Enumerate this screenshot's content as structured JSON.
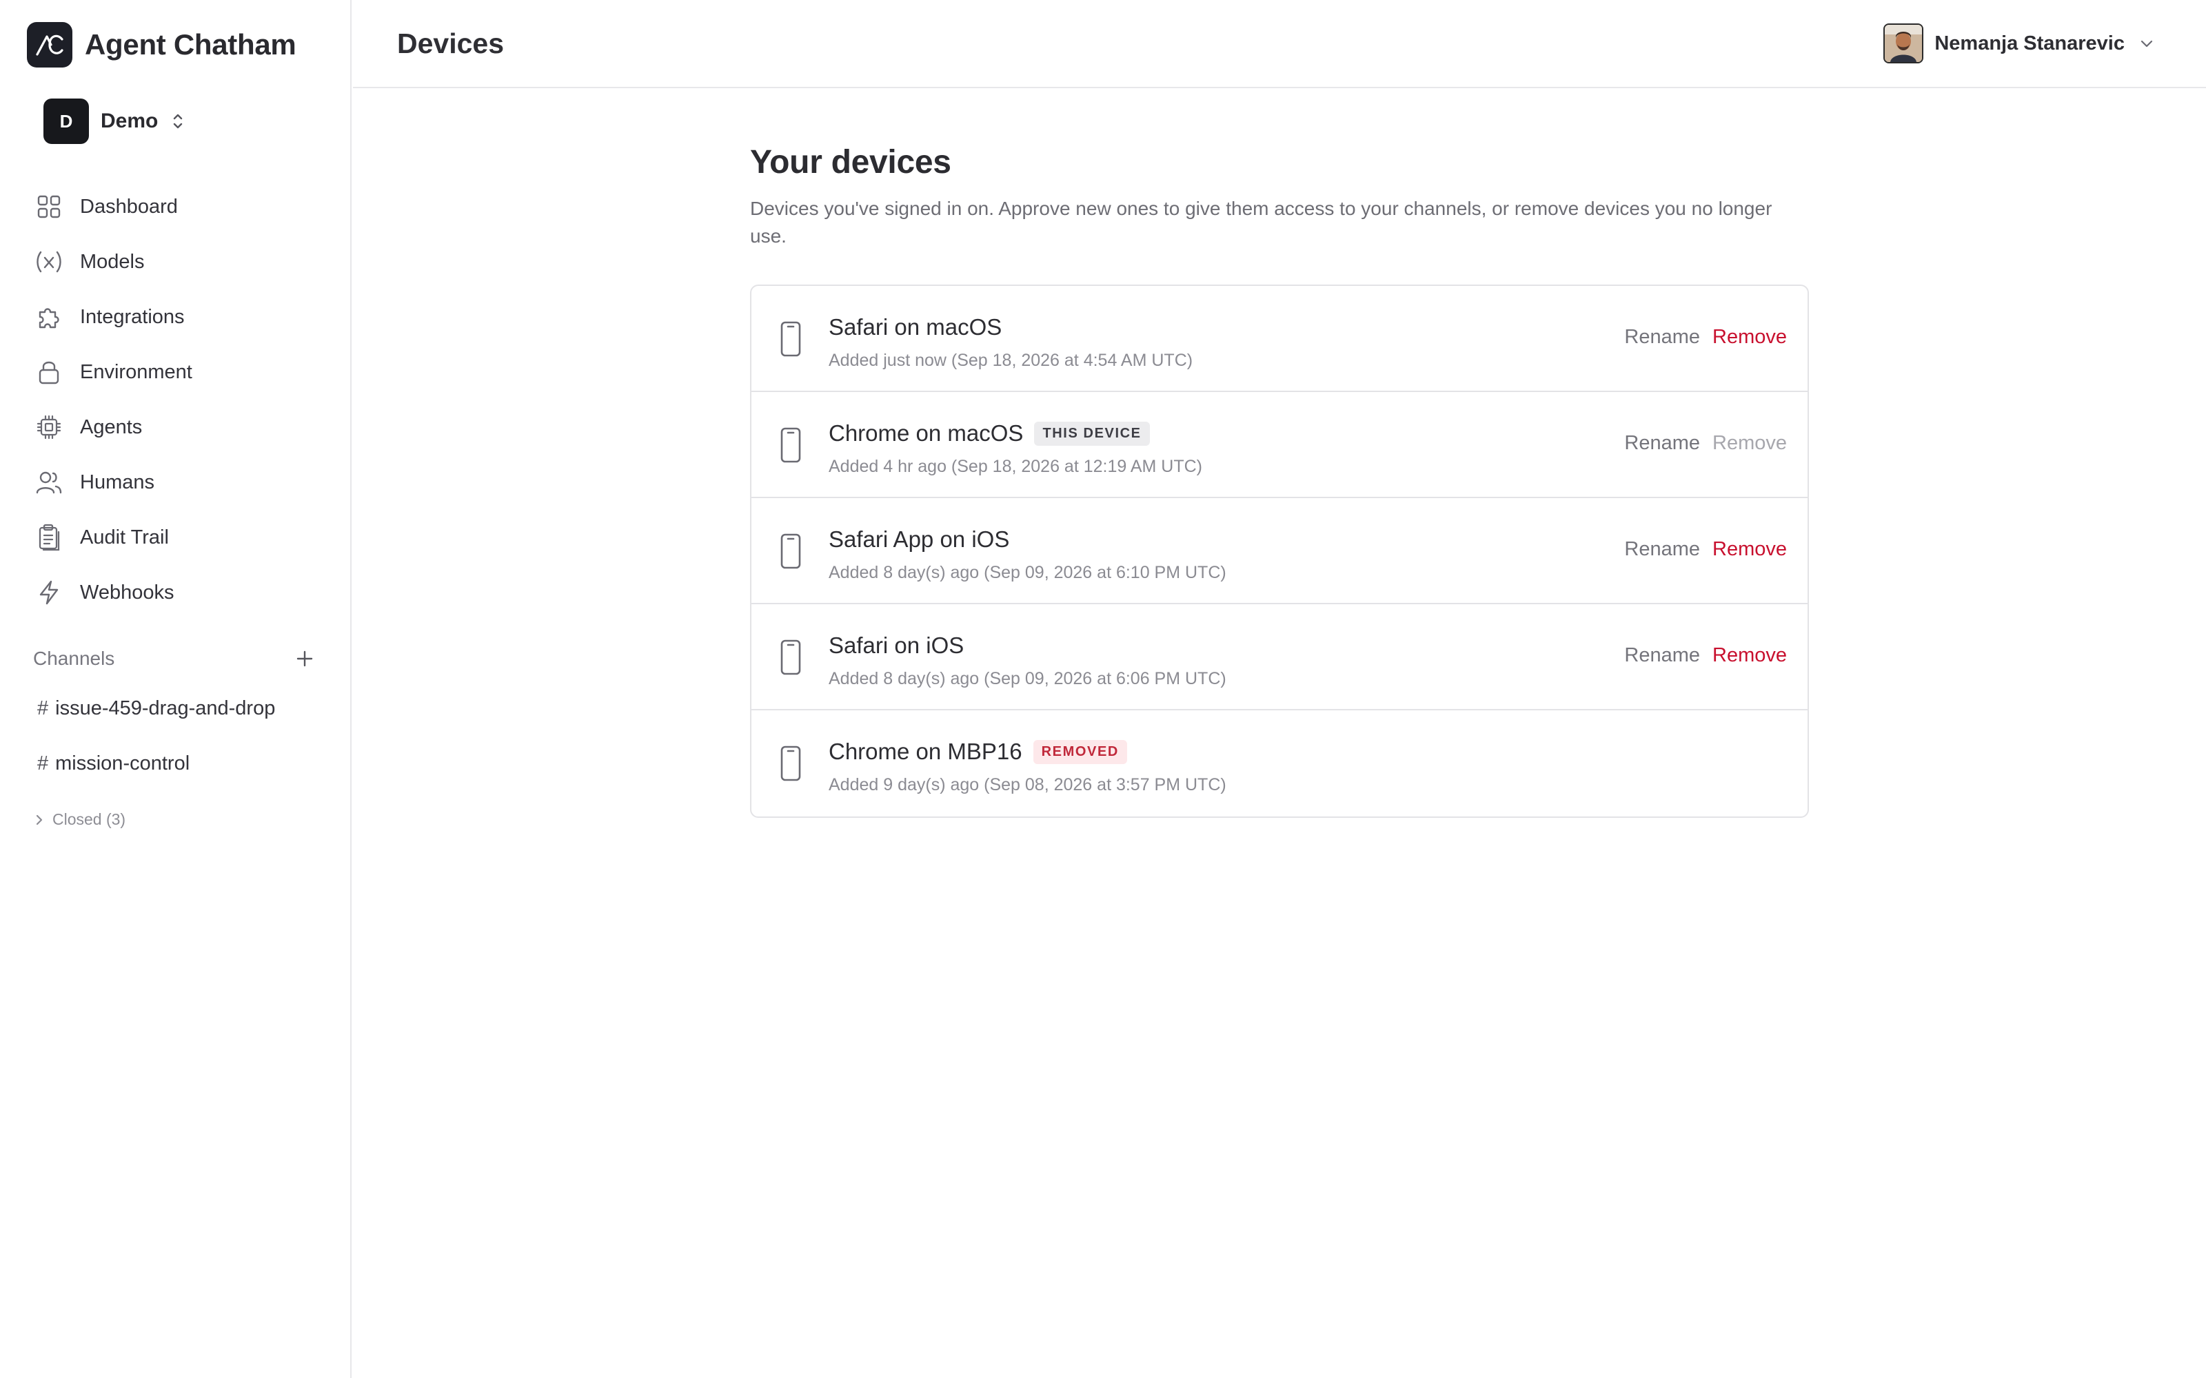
{
  "app": {
    "name": "Agent Chatham",
    "logo_icon": "agent-chatham-logo-icon"
  },
  "workspace": {
    "initial": "D",
    "name": "Demo"
  },
  "nav": {
    "items": [
      {
        "label": "Dashboard",
        "icon": "grid-icon"
      },
      {
        "label": "Models",
        "icon": "function-icon"
      },
      {
        "label": "Integrations",
        "icon": "puzzle-icon"
      },
      {
        "label": "Environment",
        "icon": "lock-icon"
      },
      {
        "label": "Agents",
        "icon": "chip-icon"
      },
      {
        "label": "Humans",
        "icon": "users-icon"
      },
      {
        "label": "Audit Trail",
        "icon": "clipboard-icon"
      },
      {
        "label": "Webhooks",
        "icon": "bolt-icon"
      }
    ]
  },
  "channels": {
    "title": "Channels",
    "items": [
      {
        "hash": "#",
        "name": "issue-459-drag-and-drop"
      },
      {
        "hash": "#",
        "name": "mission-control"
      }
    ],
    "closed_label": "Closed (3)"
  },
  "header": {
    "title": "Devices",
    "user_name": "Nemanja Stanarevic"
  },
  "main": {
    "heading": "Your devices",
    "description": "Devices you've signed in on. Approve new ones to give them access to your channels, or remove devices you no longer use.",
    "devices": [
      {
        "name": "Safari on macOS",
        "added": "Added just now (Sep 18, 2026 at 4:54 AM UTC)",
        "badge": "",
        "rename": "Rename",
        "remove": "Remove",
        "remove_enabled": true
      },
      {
        "name": "Chrome on macOS",
        "added": "Added 4 hr ago (Sep 18, 2026 at 12:19 AM UTC)",
        "badge": "THIS DEVICE",
        "rename": "Rename",
        "remove": "Remove",
        "remove_enabled": false
      },
      {
        "name": "Safari App on iOS",
        "added": "Added 8 day(s) ago (Sep 09, 2026 at 6:10 PM UTC)",
        "badge": "",
        "rename": "Rename",
        "remove": "Remove",
        "remove_enabled": true
      },
      {
        "name": "Safari on iOS",
        "added": "Added 8 day(s) ago (Sep 09, 2026 at 6:06 PM UTC)",
        "badge": "",
        "rename": "Rename",
        "remove": "Remove",
        "remove_enabled": true
      },
      {
        "name": "Chrome on MBP16",
        "added": "Added 9 day(s) ago (Sep 08, 2026 at 3:57 PM UTC)",
        "badge": "REMOVED",
        "rename": "",
        "remove": "",
        "remove_enabled": false
      }
    ]
  },
  "colors": {
    "accent_remove": "#c8102e",
    "badge_removed_bg": "#fde8ea",
    "badge_this_device_bg": "#ececee",
    "logo_bg": "#1d1f27"
  }
}
